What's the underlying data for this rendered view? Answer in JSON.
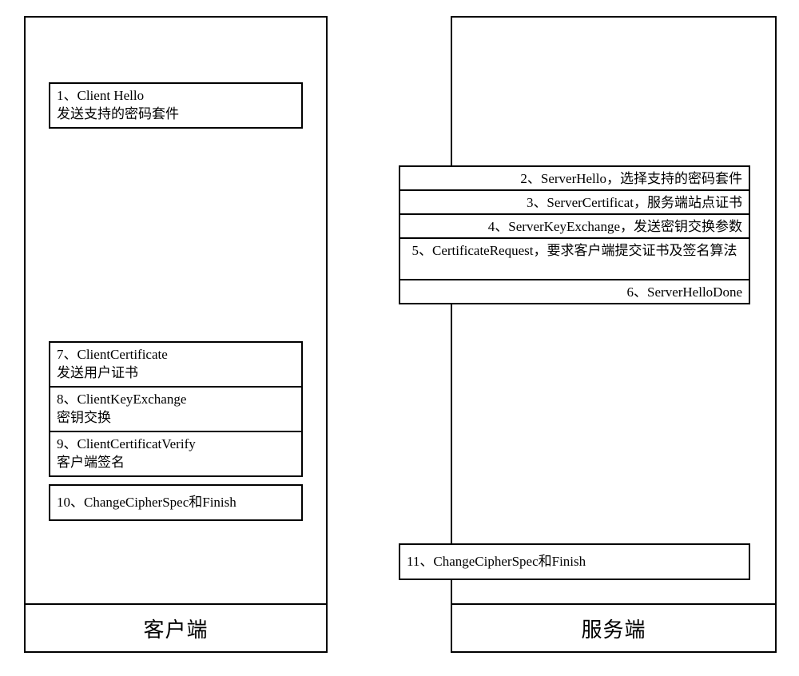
{
  "client": {
    "label": "客户端",
    "messages": [
      {
        "id": "m1",
        "text": "1、Client Hello\n发送支持的密码套件"
      },
      {
        "id": "m7",
        "text": "7、ClientCertificate\n发送用户证书"
      },
      {
        "id": "m8",
        "text": "8、ClientKeyExchange\n密钥交换"
      },
      {
        "id": "m9",
        "text": "9、ClientCertificatVerify\n客户端签名"
      },
      {
        "id": "m10",
        "text": "10、ChangeCipherSpec和Finish"
      }
    ]
  },
  "server": {
    "label": "服务端",
    "messages": [
      {
        "id": "m2",
        "text": "2、ServerHello，选择支持的密码套件"
      },
      {
        "id": "m3",
        "text": "3、ServerCertificat，服务端站点证书"
      },
      {
        "id": "m4",
        "text": "4、ServerKeyExchange，发送密钥交换参数"
      },
      {
        "id": "m5",
        "text": "5、CertificateRequest，要求客户端提交证书及签名算法"
      },
      {
        "id": "m6",
        "text": "6、ServerHelloDone"
      },
      {
        "id": "m11",
        "text": "11、ChangeCipherSpec和Finish"
      }
    ]
  }
}
